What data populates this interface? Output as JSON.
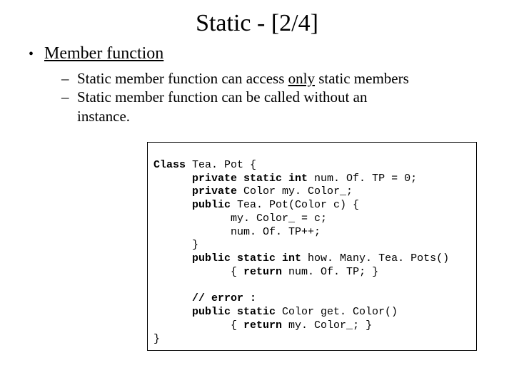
{
  "title": "Static - [2/4]",
  "heading": "Member function",
  "sub1_pre": "Static member function can access ",
  "sub1_only": "only",
  "sub1_post": " static members",
  "sub2_a": "Static member function can be called without an",
  "sub2_b": "instance.",
  "code": {
    "l01a": "Class",
    "l01b": " Tea. Pot {",
    "l02a": "      private static int",
    "l02b": " num. Of. TP = 0;",
    "l03a": "      private",
    "l03b": " Color my. Color_;",
    "l04a": "      public",
    "l04b": " Tea. Pot(Color c) {",
    "l05": "            my. Color_ = c;",
    "l06": "            num. Of. TP++;",
    "l07": "      }",
    "l08a": "      public static int",
    "l08b": " how. Many. Tea. Pots()",
    "l09a": "            { ",
    "l09b": "return",
    "l09c": " num. Of. TP; }",
    "blank": " ",
    "l10": "      // error :",
    "l11a": "      public static",
    "l11b": " Color get. Color()",
    "l12a": "            { ",
    "l12b": "return",
    "l12c": " my. Color_; }",
    "l13": "}"
  }
}
